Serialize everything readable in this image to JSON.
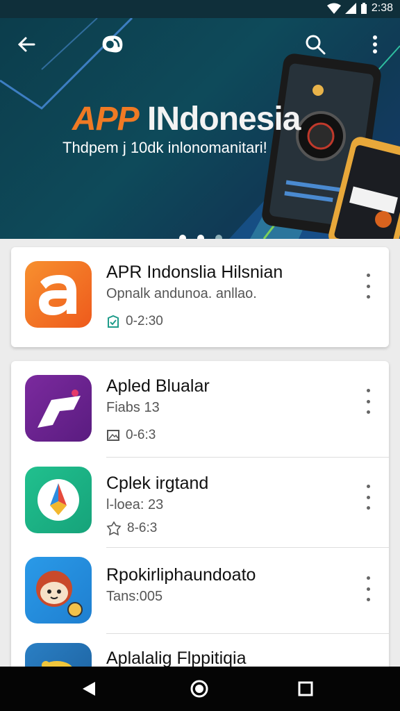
{
  "status_bar": {
    "time": "2:38"
  },
  "banner": {
    "title_part1": "APP",
    "title_part2": "INdonesia",
    "subtitle": "Thdpem j 10dk inlonomanitari!",
    "carousel_dots": 3,
    "active_dot": 2
  },
  "featured": {
    "name": "APR Indonslia Hilsnian",
    "subtitle": "Opnalk andunoa. anllao.",
    "meta": "0-2:30",
    "icon_letter": "a"
  },
  "apps": [
    {
      "name": "Apled Blualar",
      "subtitle": "Fiabs 13",
      "meta": "0-6:3"
    },
    {
      "name": "Cplek irgtand",
      "subtitle": "l-loea: 23",
      "meta": "8-6:3"
    },
    {
      "name": "Rpokirliphaundoato",
      "subtitle": "Tans:005",
      "meta": ""
    },
    {
      "name": "Aplalalig Flppitiqia",
      "subtitle": "",
      "meta": ""
    }
  ],
  "colors": {
    "accent_orange": "#f07a24",
    "hero_bg": "#0e4a5a",
    "nav_bg": "#050505"
  }
}
